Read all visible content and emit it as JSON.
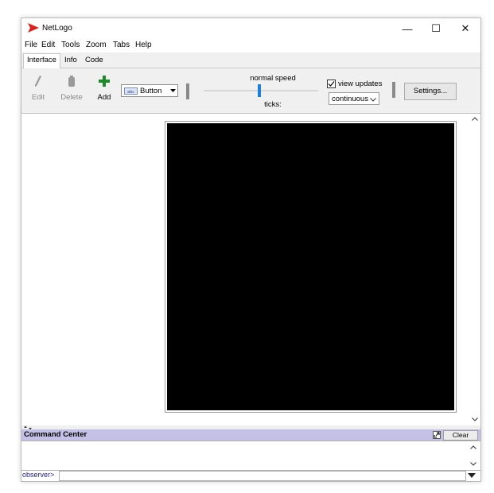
{
  "window": {
    "title": "NetLogo",
    "controls": {
      "minimize": "—",
      "maximize": "☐",
      "close": "✕"
    },
    "accent": "#e0201c"
  },
  "menu": [
    "File",
    "Edit",
    "Tools",
    "Zoom",
    "Tabs",
    "Help"
  ],
  "tabs": [
    {
      "label": "Interface",
      "active": true
    },
    {
      "label": "Info",
      "active": false
    },
    {
      "label": "Code",
      "active": false
    }
  ],
  "toolbar": {
    "edit_label": "Edit",
    "delete_label": "Delete",
    "add_label": "Add",
    "widget_type": "Button",
    "speed_label": "normal speed",
    "speed_value": 0.5,
    "ticks_label": "ticks:",
    "view_updates_label": "view updates",
    "view_updates_checked": true,
    "update_mode": "continuous",
    "settings_label": "Settings..."
  },
  "view": {
    "background": "#000000"
  },
  "command_center": {
    "title": "Command Center",
    "clear_label": "Clear",
    "prompt": "observer>",
    "header_color": "#c5c0e5"
  }
}
